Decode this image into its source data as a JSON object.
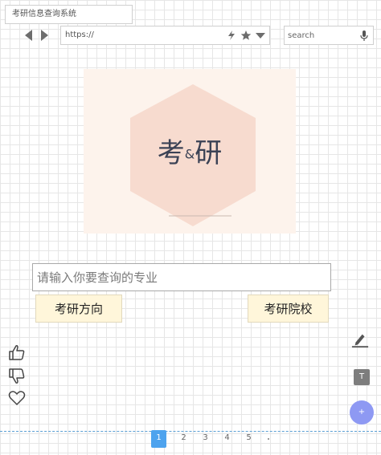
{
  "window": {
    "tab_title": "考研信息查询系统",
    "url": "https://",
    "search_placeholder": "search"
  },
  "logo": {
    "text_left": "考",
    "text_amp": "&",
    "text_right": "研"
  },
  "query": {
    "placeholder": "请输入你要查询的专业",
    "value": ""
  },
  "buttons": {
    "direction": "考研方向",
    "school": "考研院校"
  },
  "tools": {
    "text_tool_label": "T",
    "fab_label": "+"
  },
  "pagination": {
    "pages": [
      "1",
      "2",
      "3",
      "4",
      "5"
    ],
    "active": "1"
  },
  "colors": {
    "logo_bg": "#fdf3ec",
    "hexagon": "#f7dbcf",
    "button_bg": "#fff6da",
    "page_active": "#4ea3ee",
    "fab": "#8e99f3"
  }
}
